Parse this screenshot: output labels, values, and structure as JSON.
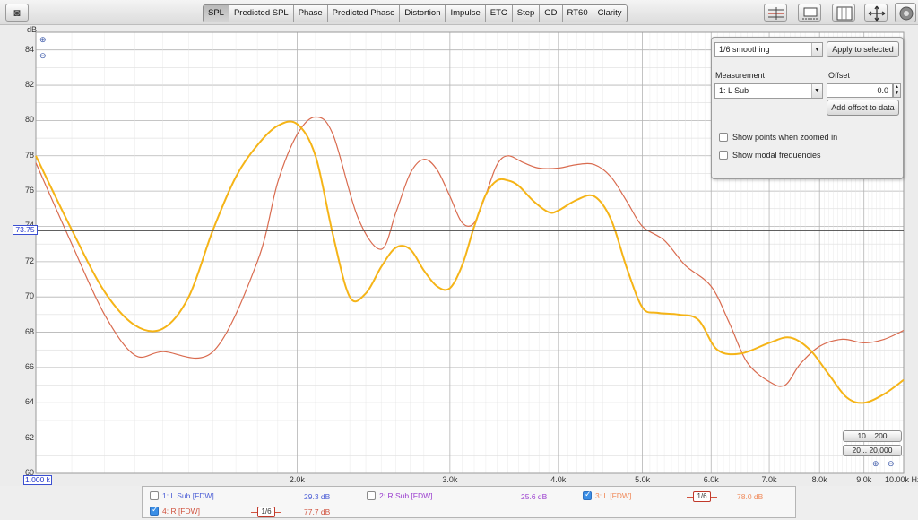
{
  "toolbar": {
    "tabs": [
      "SPL",
      "Predicted SPL",
      "Phase",
      "Predicted Phase",
      "Distortion",
      "Impulse",
      "ETC",
      "Step",
      "GD",
      "RT60",
      "Clarity"
    ],
    "active_tab": "SPL",
    "right_icons": [
      "controls-toggle-icon",
      "legend-toggle-icon",
      "split-panes-icon",
      "pan-zoom-icon",
      "capture-icon"
    ]
  },
  "graph": {
    "y_unit": "dB",
    "cursor_level": "73.75",
    "start_freq": "1.000 k",
    "y_ticks": [
      "84",
      "82",
      "80",
      "78",
      "76",
      "74",
      "72",
      "70",
      "68",
      "66",
      "64",
      "62",
      "60"
    ],
    "x_ticks": [
      "2.0k",
      "3.0k",
      "4.0k",
      "5.0k",
      "6.0k",
      "7.0k",
      "8.0k",
      "9.0k",
      "10.00k Hz"
    ],
    "colors": {
      "r_trace": "#d96b4f",
      "l_trace": "#f5b417",
      "cursor": "#4a4a4a",
      "grid": "#c9c9c9",
      "grid_major": "#b4b4b4"
    }
  },
  "controls": {
    "smoothing": "1/6 smoothing",
    "apply_button": "Apply to selected",
    "measurement_label": "Measurement",
    "measurement_value": "1: L Sub",
    "offset_label": "Offset",
    "offset_value": "0.0",
    "add_offset_button": "Add offset to data",
    "show_points_label": "Show points when zoomed in",
    "show_modal_label": "Show modal frequencies"
  },
  "range_buttons": [
    "10 .. 200",
    "20 .. 20,000"
  ],
  "legend": {
    "items": [
      {
        "label": "1: L Sub [FDW]",
        "value": "29.3 dB",
        "checked": false,
        "color": "#4d5fd6"
      },
      {
        "label": "2: R Sub [FDW]",
        "value": "25.6 dB",
        "checked": false,
        "color": "#9b3fcf"
      },
      {
        "label": "3: L [FDW]",
        "value": "78.0 dB",
        "checked": true,
        "color": "#f08a5a",
        "smoothing": "1/6"
      },
      {
        "label": "4: R [FDW]",
        "value": "77.7 dB",
        "checked": true,
        "color": "#d0533f",
        "smoothing": "1/6"
      }
    ]
  },
  "chart_data": {
    "type": "line",
    "xlabel": "Hz",
    "ylabel": "dB",
    "x_scale": "log",
    "xlim": [
      1000,
      10000
    ],
    "ylim": [
      60,
      85
    ],
    "cursor_y": 73.75,
    "grid": true,
    "series": [
      {
        "name": "4: R [FDW]",
        "color": "#d96b4f",
        "x": [
          1000,
          1100,
          1200,
          1300,
          1400,
          1600,
          1800,
          1900,
          2000,
          2100,
          2200,
          2350,
          2500,
          2600,
          2700,
          2800,
          2900,
          3000,
          3100,
          3200,
          3300,
          3400,
          3500,
          3650,
          3800,
          4000,
          4200,
          4400,
          4600,
          4800,
          5000,
          5300,
          5600,
          6000,
          6300,
          6600,
          7000,
          7300,
          7600,
          8000,
          8500,
          9000,
          9500,
          10000
        ],
        "y": [
          77.6,
          73.0,
          69.0,
          66.7,
          66.9,
          66.9,
          72.0,
          76.5,
          79.2,
          80.2,
          79.2,
          74.5,
          72.7,
          74.8,
          77.0,
          77.8,
          77.2,
          75.7,
          74.2,
          74.2,
          75.8,
          77.5,
          78.0,
          77.6,
          77.3,
          77.3,
          77.5,
          77.5,
          76.8,
          75.4,
          74.0,
          73.2,
          71.8,
          70.6,
          68.5,
          66.3,
          65.2,
          65.0,
          66.2,
          67.2,
          67.6,
          67.4,
          67.6,
          68.1
        ]
      },
      {
        "name": "3: L [FDW]",
        "color": "#f5b417",
        "x": [
          1000,
          1100,
          1200,
          1300,
          1400,
          1500,
          1600,
          1700,
          1800,
          1900,
          2000,
          2100,
          2200,
          2300,
          2400,
          2500,
          2600,
          2700,
          2800,
          2900,
          3000,
          3100,
          3200,
          3300,
          3400,
          3500,
          3600,
          3750,
          3900,
          4000,
          4200,
          4400,
          4600,
          4800,
          5000,
          5200,
          5500,
          5800,
          6100,
          6500,
          7000,
          7400,
          7800,
          8200,
          8600,
          9000,
          9500,
          10000
        ],
        "y": [
          78.0,
          73.8,
          70.3,
          68.4,
          68.2,
          70.0,
          73.8,
          76.8,
          78.6,
          79.7,
          79.8,
          78.0,
          73.5,
          70.0,
          70.2,
          71.7,
          72.8,
          72.7,
          71.5,
          70.6,
          70.5,
          71.8,
          74.0,
          75.8,
          76.6,
          76.6,
          76.3,
          75.4,
          74.8,
          74.9,
          75.5,
          75.7,
          74.4,
          71.6,
          69.4,
          69.1,
          69.0,
          68.7,
          67.0,
          66.8,
          67.4,
          67.7,
          67.0,
          65.6,
          64.3,
          64.0,
          64.5,
          65.3
        ]
      }
    ]
  }
}
